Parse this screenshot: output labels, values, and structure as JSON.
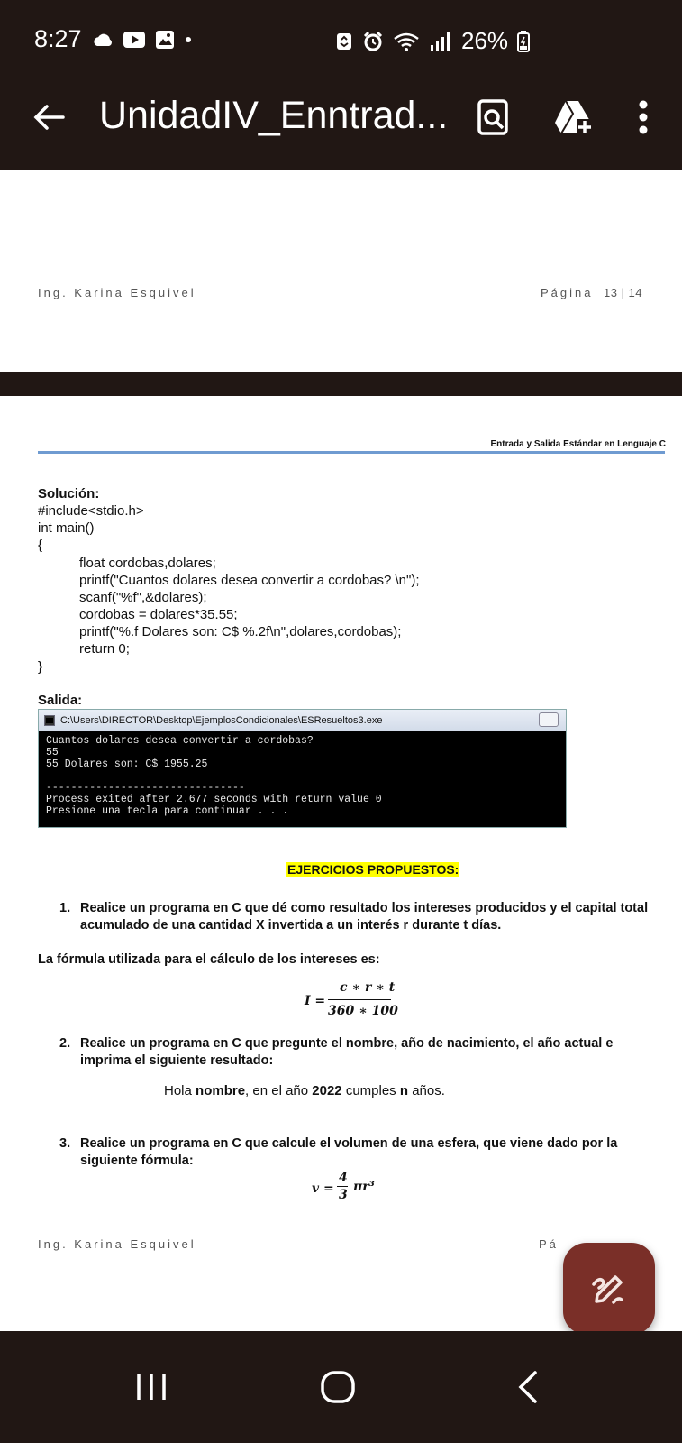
{
  "status_bar": {
    "time": "8:27",
    "battery_percent": "26%",
    "icons": [
      "cloud-icon",
      "youtube-icon",
      "gallery-icon",
      "dot-icon",
      "recycle-icon",
      "alarm-icon",
      "wifi-icon",
      "signal-icon",
      "battery-icon"
    ]
  },
  "app_bar": {
    "title": "UnidadIV_Enntrad...",
    "icons": [
      "back-arrow-icon",
      "search-document-icon",
      "add-to-drive-icon",
      "more-vertical-icon"
    ]
  },
  "document": {
    "prev_page_footer": {
      "author": "Ing. Karina Esquivel",
      "page_label": "Página",
      "page_num": "13 | 14"
    },
    "header": "Entrada y Salida Estándar en Lenguaje C",
    "solution_title": "Solución:",
    "code_lines": [
      "#include<stdio.h>",
      "int main()",
      "{",
      "float cordobas,dolares;",
      "printf(\"Cuantos dolares desea convertir a cordobas? \\n\");",
      "scanf(\"%f\",&dolares);",
      "cordobas = dolares*35.55;",
      "printf(\"%.f Dolares son: C$ %.2f\\n\",dolares,cordobas);",
      "return 0;",
      "}"
    ],
    "output_title": "Salida:",
    "console": {
      "window_title": "C:\\Users\\DIRECTOR\\Desktop\\EjemplosCondicionales\\ESResueltos3.exe",
      "lines": [
        "Cuantos dolares desea convertir a cordobas?",
        "55",
        "55 Dolares son: C$ 1955.25",
        "",
        "--------------------------------",
        "Process exited after 2.677 seconds with return value 0",
        "Presione una tecla para continuar . . ."
      ]
    },
    "exercises_title": "EJERCICIOS PROPUESTOS:",
    "exercise_1": {
      "num": "1.",
      "text": "Realice un programa en C que dé como resultado los intereses producidos y el capital total acumulado de una cantidad X invertida a un interés r durante t días."
    },
    "formula_label": "La fórmula utilizada para el cálculo de los intereses es:",
    "formula_1": {
      "lhs": "I =",
      "numerator": "c ∗ r ∗ t",
      "denominator": "360 ∗ 100"
    },
    "exercise_2": {
      "num": "2.",
      "text": "Realice un programa en C que pregunte el nombre, año de nacimiento, el año actual e imprima el siguiente resultado:"
    },
    "hola_line": {
      "p1": "Hola ",
      "b1": "nombre",
      "p2": ", en el año ",
      "b2": "2022",
      "p3": " cumples ",
      "b3": "n",
      "p4": " años."
    },
    "exercise_3": {
      "num": "3.",
      "text": "Realice un programa en C que calcule el volumen de una esfera, que viene dado por la siguiente fórmula:"
    },
    "formula_2": {
      "lhs": "v =",
      "numerator": "4",
      "denominator": "3",
      "rhs": "πr³"
    },
    "bottom_footer": {
      "author": "Ing. Karina Esquivel",
      "page_label_partial": "Pá"
    }
  },
  "fab": {
    "icon": "edit-pen-icon"
  },
  "nav_bar": {
    "icons": [
      "recent-apps-icon",
      "home-icon",
      "back-icon"
    ]
  },
  "colors": {
    "system_bar": "#211714",
    "fab": "#7a2f28",
    "header_rule": "#6f9bd1",
    "highlight": "#ffff00",
    "console_bg": "#000000"
  }
}
